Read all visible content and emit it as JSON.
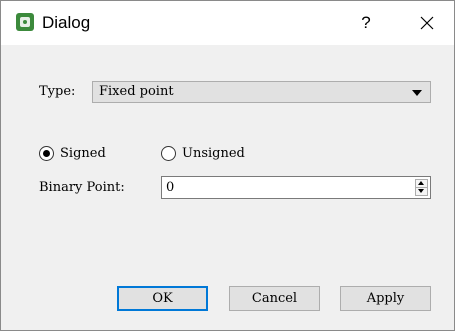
{
  "window": {
    "title": "Dialog",
    "help_label": "?",
    "icons": {
      "app": "app-icon",
      "close": "close-icon"
    }
  },
  "form": {
    "type_label": "Type:",
    "type_value": "Fixed point",
    "signed_label": "Signed",
    "unsigned_label": "Unsigned",
    "signed_selected": true,
    "binary_point_label": "Binary Point:",
    "binary_point_value": "0"
  },
  "buttons": {
    "ok": "OK",
    "cancel": "Cancel",
    "apply": "Apply"
  },
  "colors": {
    "accent": "#0078d7",
    "face": "#f0f0f0",
    "button": "#e1e1e1"
  }
}
